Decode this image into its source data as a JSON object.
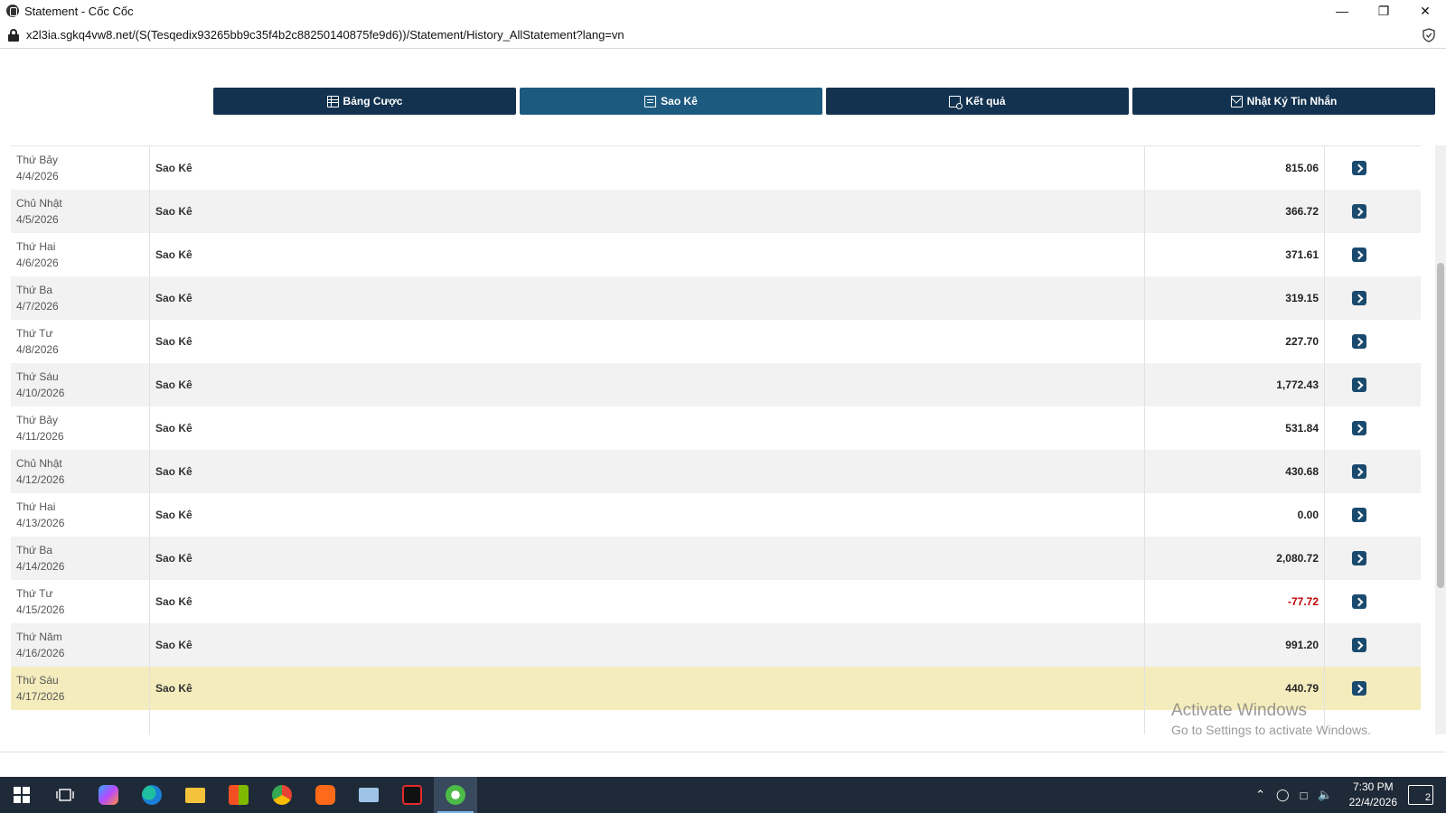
{
  "window": {
    "title": "Statement - Cốc Cốc",
    "url": "x2l3ia.sgkq4vw8.net/(S(Tesqedix93265bb9c35f4b2c88250140875fe9d6))/Statement/History_AllStatement?lang=vn"
  },
  "nav": [
    {
      "label": "Bảng Cược",
      "icon": "table-icon",
      "active": false
    },
    {
      "label": "Sao Kê",
      "icon": "document-icon",
      "active": true
    },
    {
      "label": "Kết quả",
      "icon": "result-icon",
      "active": false
    },
    {
      "label": "Nhật Ký Tin Nhắn",
      "icon": "mail-icon",
      "active": false
    }
  ],
  "rows": [
    {
      "day": "Thứ Bảy",
      "date": "4/4/2026",
      "type": "Sao Kê",
      "amount": "815.06",
      "negative": false
    },
    {
      "day": "Chủ Nhật",
      "date": "4/5/2026",
      "type": "Sao Kê",
      "amount": "366.72",
      "negative": false
    },
    {
      "day": "Thứ Hai",
      "date": "4/6/2026",
      "type": "Sao Kê",
      "amount": "371.61",
      "negative": false
    },
    {
      "day": "Thứ Ba",
      "date": "4/7/2026",
      "type": "Sao Kê",
      "amount": "319.15",
      "negative": false
    },
    {
      "day": "Thứ Tư",
      "date": "4/8/2026",
      "type": "Sao Kê",
      "amount": "227.70",
      "negative": false
    },
    {
      "day": "Thứ Sáu",
      "date": "4/10/2026",
      "type": "Sao Kê",
      "amount": "1,772.43",
      "negative": false
    },
    {
      "day": "Thứ Bảy",
      "date": "4/11/2026",
      "type": "Sao Kê",
      "amount": "531.84",
      "negative": false
    },
    {
      "day": "Chủ Nhật",
      "date": "4/12/2026",
      "type": "Sao Kê",
      "amount": "430.68",
      "negative": false
    },
    {
      "day": "Thứ Hai",
      "date": "4/13/2026",
      "type": "Sao Kê",
      "amount": "0.00",
      "negative": false
    },
    {
      "day": "Thứ Ba",
      "date": "4/14/2026",
      "type": "Sao Kê",
      "amount": "2,080.72",
      "negative": false
    },
    {
      "day": "Thứ Tư",
      "date": "4/15/2026",
      "type": "Sao Kê",
      "amount": "-77.72",
      "negative": true
    },
    {
      "day": "Thứ Năm",
      "date": "4/16/2026",
      "type": "Sao Kê",
      "amount": "991.20",
      "negative": false
    },
    {
      "day": "Thứ Sáu",
      "date": "4/17/2026",
      "type": "Sao Kê",
      "amount": "440.79",
      "negative": false,
      "highlighted": true
    }
  ],
  "watermark": {
    "line1": "Activate Windows",
    "line2": "Go to Settings to activate Windows."
  },
  "taskbar": {
    "time": "7:30 PM",
    "date": "22/4/2026",
    "notifications": "2",
    "apps": [
      "start-icon",
      "task-view-icon",
      "copilot-icon",
      "edge-icon",
      "file-explorer-icon",
      "store-icon",
      "chrome-icon",
      "media-player-icon",
      "remote-desktop-icon",
      "garena-icon",
      "coccoc-icon"
    ]
  },
  "colors": {
    "nav_bg": "#12324f",
    "nav_active": "#1d5a80",
    "negative": "#c00000",
    "highlight_row": "#f5ecbd"
  }
}
